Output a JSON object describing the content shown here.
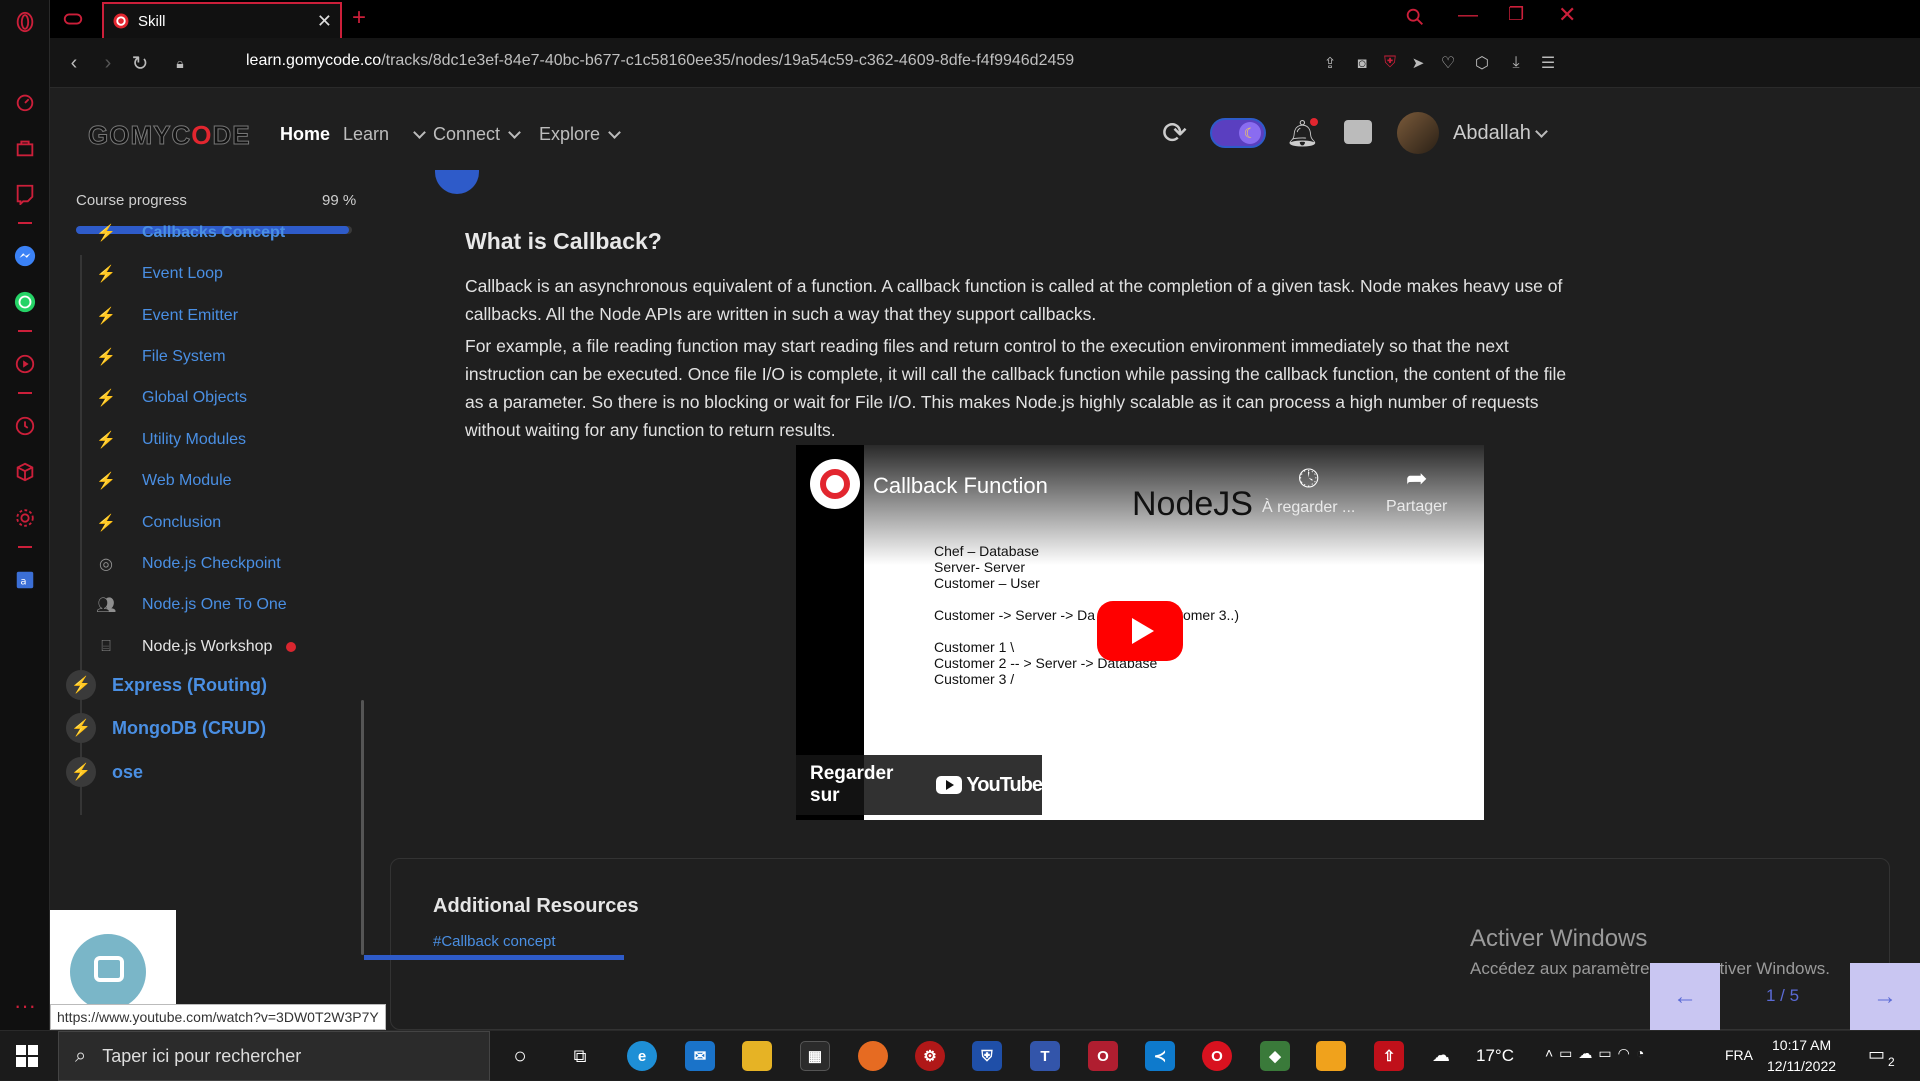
{
  "browser": {
    "tab_title": "Skill",
    "url_host": "learn.gomycode.co",
    "url_path": "/tracks/8dc1e3ef-84e7-40bc-b677-c1c58160ee35/nodes/19a54c59-c362-4609-8dfe-f4f9946d2459",
    "accent_color": "#cc1f3a"
  },
  "header": {
    "logo_text_pre": "GOMYC",
    "logo_text_o": "O",
    "logo_text_post": "DE",
    "nav": [
      {
        "label": "Home",
        "active": true
      },
      {
        "label": "Learn"
      },
      {
        "label": "Connect"
      },
      {
        "label": "Explore"
      }
    ],
    "user_name": "Abdallah"
  },
  "course": {
    "progress_label": "Course progress",
    "progress_text": "99 %",
    "progress_fraction": 0.99,
    "lessons": [
      {
        "label": "Callbacks Concept",
        "icon": "bolt-icon",
        "current": true
      },
      {
        "label": "Event Loop",
        "icon": "bolt-icon"
      },
      {
        "label": "Event Emitter",
        "icon": "bolt-icon"
      },
      {
        "label": "File System",
        "icon": "bolt-icon"
      },
      {
        "label": "Global Objects",
        "icon": "bolt-icon"
      },
      {
        "label": "Utility Modules",
        "icon": "bolt-icon"
      },
      {
        "label": "Web Module",
        "icon": "bolt-icon"
      },
      {
        "label": "Conclusion",
        "icon": "bolt-icon"
      },
      {
        "label": "Node.js Checkpoint",
        "icon": "target-icon"
      },
      {
        "label": "Node.js One To One",
        "icon": "people-icon"
      },
      {
        "label": "Node.js Workshop",
        "icon": "workshop-icon",
        "plain": true
      }
    ],
    "modules": [
      {
        "label": "Express (Routing)"
      },
      {
        "label": "MongoDB (CRUD)"
      },
      {
        "label": "ose"
      }
    ]
  },
  "main": {
    "title": "What is Callback?",
    "paragraph_1": "Callback is an asynchronous equivalent of a function. A callback function is called at the completion of a given task. Node makes heavy use of callbacks. All the Node APIs are written in such a way that they support callbacks.",
    "paragraph_2": "For example, a file reading function may start reading files and return control to the execution environment immediately so that the next instruction can be executed. Once file I/O is complete, it will call the callback function while passing the callback function, the content of the file as a parameter. So there is no blocking or wait for File I/O. This makes Node.js highly scalable as it can process a high number of requests without waiting for any function to return results."
  },
  "video": {
    "title": "Callback Function",
    "slide_heading": "NodeJS",
    "watch_later": "À regarder ...",
    "share": "Partager",
    "slide_lines": [
      "Chef – Database",
      "Server- Server",
      "Customer – User",
      "",
      "Customer -> Server -> Da                    tomer 2, Customer 3..)",
      "",
      "Customer 1 \\",
      "Customer 2 -- > Server -> Database",
      "Customer 3 /"
    ],
    "watch_on": "Regarder sur",
    "youtube": "YouTube"
  },
  "resources": {
    "title": "Additional Resources",
    "link": "#Callback concept"
  },
  "pager": {
    "label": "1 / 5",
    "prev": "←",
    "next": "→"
  },
  "windows_watermark": {
    "line1": "Activer Windows",
    "line2": "Accédez aux paramètres pour activer Windows."
  },
  "status_url": "https://www.youtube.com/watch?v=3DW0T2W3P7Y",
  "taskbar": {
    "search_placeholder": "Taper ici pour rechercher",
    "weather": "17°C",
    "lang": "FRA",
    "time": "10:17 AM",
    "date": "12/11/2022",
    "notif_count": "2"
  }
}
